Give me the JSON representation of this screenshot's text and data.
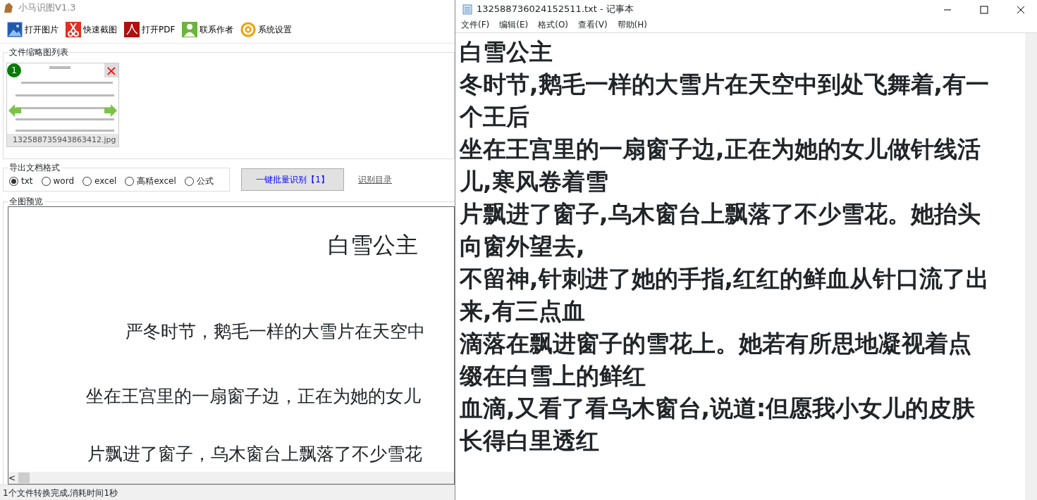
{
  "app": {
    "title": "小马识图V1.3",
    "toolbar": [
      {
        "label": "打开图片",
        "kind": "image"
      },
      {
        "label": "快速截图",
        "kind": "scissors"
      },
      {
        "label": "打开PDF",
        "kind": "pdf"
      },
      {
        "label": "联系作者",
        "kind": "person"
      },
      {
        "label": "系统设置",
        "kind": "at"
      }
    ],
    "thumbnails": {
      "title": "文件缩略图列表",
      "items": [
        {
          "number": "1",
          "filename": "132588735943863412.jpg",
          "close": "×"
        }
      ]
    },
    "export": {
      "title": "导出文档格式",
      "options": [
        {
          "label": "txt",
          "selected": true
        },
        {
          "label": "word",
          "selected": false
        },
        {
          "label": "excel",
          "selected": false
        },
        {
          "label": "高精excel",
          "selected": false
        },
        {
          "label": "公式",
          "selected": false
        }
      ],
      "button": "一键批量识别【1】",
      "link": "识别目录"
    },
    "preview": {
      "title": "全图预览",
      "heading": "白雪公主",
      "lines": [
        "严冬时节，鹅毛一样的大雪片在天空中",
        "坐在王宫里的一扇窗子边，正在为她的女儿",
        "片飘进了窗子，乌木窗台上飘落了不少雪花"
      ],
      "scroll_left": "<"
    },
    "status_bar": "1个文件转换完成,消耗时间1秒"
  },
  "notepad": {
    "title": "132588736024152511.txt - 记事本",
    "menu": [
      "文件(F)",
      "编辑(E)",
      "格式(O)",
      "查看(V)",
      "帮助(H)"
    ],
    "lines": [
      "白雪公主",
      "冬时节,鹅毛一样的大雪片在天空中到处飞舞着,有一",
      "个王后",
      "坐在王宫里的一扇窗子边,正在为她的女儿做针线活",
      "儿,寒风卷着雪",
      "片飘进了窗子,乌木窗台上飘落了不少雪花。她抬头",
      "向窗外望去,",
      "不留神,针刺进了她的手指,红红的鲜血从针口流了出",
      "来,有三点血",
      "滴落在飘进窗子的雪花上。她若有所思地凝视着点",
      "缀在白雪上的鲜红",
      "血滴,又看了看乌木窗台,说道:但愿我小女儿的皮肤",
      "长得白里透红"
    ]
  }
}
